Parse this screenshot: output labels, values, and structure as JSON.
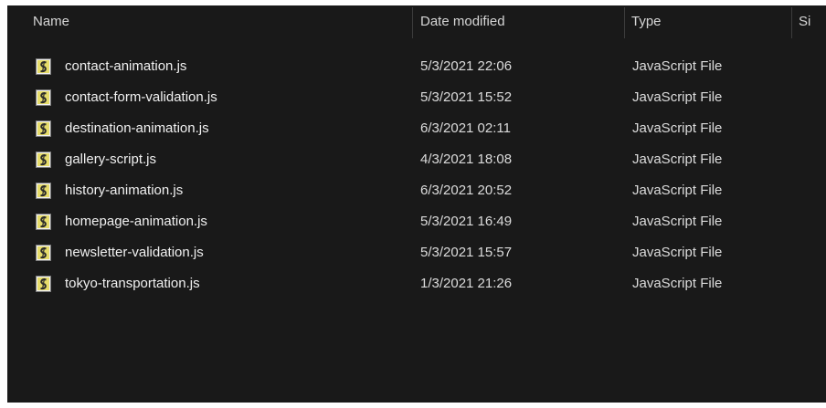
{
  "header": {
    "name": "Name",
    "date_modified": "Date modified",
    "type": "Type",
    "size": "Si"
  },
  "files": [
    {
      "name": "contact-animation.js",
      "date": "5/3/2021 22:06",
      "type": "JavaScript File",
      "icon": "javascript-file-icon"
    },
    {
      "name": "contact-form-validation.js",
      "date": "5/3/2021 15:52",
      "type": "JavaScript File",
      "icon": "javascript-file-icon"
    },
    {
      "name": "destination-animation.js",
      "date": "6/3/2021 02:11",
      "type": "JavaScript File",
      "icon": "javascript-file-icon"
    },
    {
      "name": "gallery-script.js",
      "date": "4/3/2021 18:08",
      "type": "JavaScript File",
      "icon": "javascript-file-icon"
    },
    {
      "name": "history-animation.js",
      "date": "6/3/2021 20:52",
      "type": "JavaScript File",
      "icon": "javascript-file-icon"
    },
    {
      "name": "homepage-animation.js",
      "date": "5/3/2021 16:49",
      "type": "JavaScript File",
      "icon": "javascript-file-icon"
    },
    {
      "name": "newsletter-validation.js",
      "date": "5/3/2021 15:57",
      "type": "JavaScript File",
      "icon": "javascript-file-icon"
    },
    {
      "name": "tokyo-transportation.js",
      "date": "1/3/2021 21:26",
      "type": "JavaScript File",
      "icon": "javascript-file-icon"
    }
  ],
  "colors": {
    "background": "#191919",
    "text": "#ececec",
    "separator": "#3c3c3c"
  }
}
